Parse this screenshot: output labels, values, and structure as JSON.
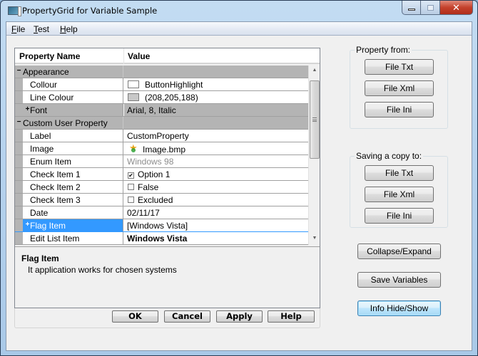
{
  "window": {
    "title": "PropertyGrid for Variable Sample",
    "controls": {
      "minimize": "minimize",
      "maximize": "maximize",
      "close": "close"
    }
  },
  "menu": [
    {
      "label": "File",
      "accel": "F"
    },
    {
      "label": "Test",
      "accel": "T"
    },
    {
      "label": "Help",
      "accel": "H"
    }
  ],
  "grid": {
    "columns": {
      "name": "Property Name",
      "value": "Value"
    },
    "rows": [
      {
        "type": "category",
        "expander": "−",
        "name": "Appearance",
        "value": ""
      },
      {
        "type": "item",
        "name": "Collour",
        "value": "ButtonHighlight",
        "swatch": "#ffffff"
      },
      {
        "type": "item",
        "name": "Line Colour",
        "value": "(208,205,188)",
        "swatch": "#c8c8c8"
      },
      {
        "type": "sub",
        "expander": "+",
        "name": "Font",
        "value": "Arial, 8, Italic"
      },
      {
        "type": "category",
        "expander": "−",
        "name": "Custom User Property",
        "value": ""
      },
      {
        "type": "item",
        "name": "Label",
        "value": "CustomProperty"
      },
      {
        "type": "item",
        "name": "Image",
        "value": "Image.bmp",
        "icon": "star-image-icon"
      },
      {
        "type": "item",
        "name": "Enum Item",
        "value": "Windows 98",
        "disabled": true
      },
      {
        "type": "item",
        "name": "Check Item 1",
        "value": "Option 1",
        "checked": true
      },
      {
        "type": "item",
        "name": "Check Item 2",
        "value": "False",
        "checked": false
      },
      {
        "type": "item",
        "name": "Check Item 3",
        "value": "Excluded",
        "checked": false
      },
      {
        "type": "item",
        "name": "Date",
        "value": "02/11/17"
      },
      {
        "type": "selected",
        "expander": "+",
        "name": "Flag Item",
        "value": "[Windows Vista]"
      },
      {
        "type": "item",
        "name": "Edit List Item",
        "value": "Windows Vista",
        "bold": true
      }
    ],
    "help": {
      "title": "Flag Item",
      "description": "It application works for chosen systems"
    },
    "buttons": {
      "ok": "OK",
      "cancel": "Cancel",
      "apply": "Apply",
      "help": "Help"
    }
  },
  "property_from": {
    "label": "Property from:",
    "buttons": [
      "File Txt",
      "File Xml",
      "File Ini"
    ]
  },
  "saving_copy": {
    "label": "Saving a copy to:",
    "buttons": [
      "File Txt",
      "File Xml",
      "File Ini"
    ]
  },
  "actions": {
    "collapse_expand": "Collapse/Expand",
    "save_variables": "Save Variables",
    "info_hide_show": "Info Hide/Show"
  },
  "colors": {
    "selection": "#3399ff",
    "category_bg": "#b4b4b4",
    "focused_button_border": "#3c7fb1"
  }
}
